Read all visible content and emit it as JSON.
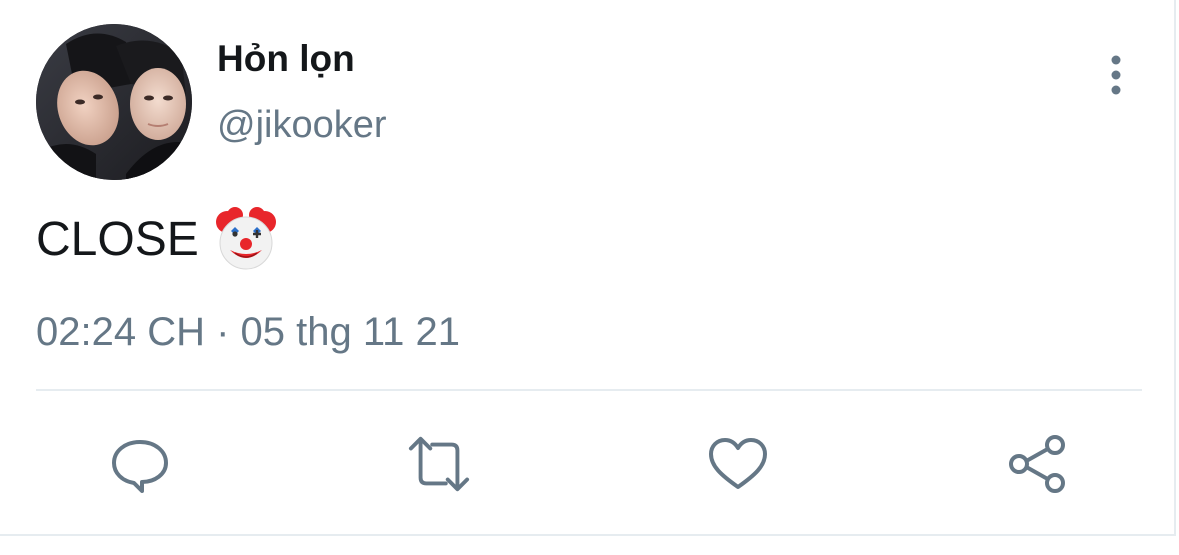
{
  "tweet": {
    "display_name": "Hỏn lọn",
    "handle": "@jikooker",
    "text": "CLOSE",
    "emoji": "clown-face",
    "timestamp": "02:24 CH · 05 thg 11 21"
  },
  "icons": {
    "more": "more-vertical-icon",
    "reply": "reply-icon",
    "retweet": "retweet-icon",
    "like": "like-heart-icon",
    "share": "share-icon"
  },
  "colors": {
    "text_primary": "#14171a",
    "text_secondary": "#657786",
    "divider": "#e6ecf0",
    "clown_red": "#e8262b"
  }
}
